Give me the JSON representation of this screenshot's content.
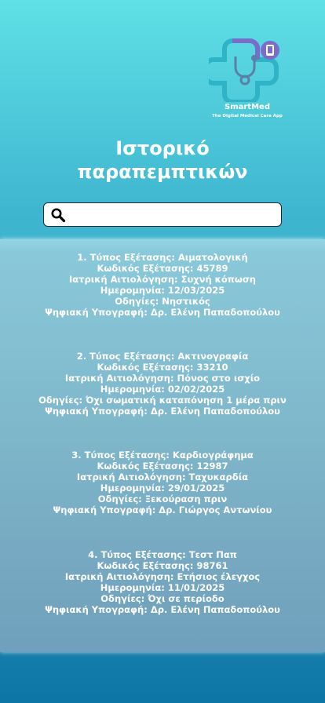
{
  "app": {
    "name": "SmartMed",
    "tagline": "The Digital Medical Care App"
  },
  "page": {
    "title_line1": "Ιστορικό",
    "title_line2": "παραπεμπτικών"
  },
  "search": {
    "value": "",
    "placeholder": ""
  },
  "referrals": [
    {
      "type": "1. Τύπος Εξέτασης: Αιματολογική",
      "code": "Κωδικός Εξέτασης: 45789",
      "reason": "Ιατρική Αιτιολόγηση: Συχνή κόπωση",
      "date": "Ημερομηνία: 12/03/2025",
      "instructions": "Οδηγίες: Νηστικός",
      "signature": "Ψηφιακή Υπογραφή: Δρ. Ελένη Παπαδοπούλου"
    },
    {
      "type": "2. Τύπος Εξέτασης: Ακτινογραφία",
      "code": "Κωδικός Εξέτασης: 33210",
      "reason": "Ιατρική Αιτιολόγηση: Πόνος στο ισχίο",
      "date": "Ημερομηνία: 02/02/2025",
      "instructions": "Οδηγίες: Όχι σωματική καταπόνηση 1 μέρα πριν",
      "signature": "Ψηφιακή Υπογραφή: Δρ. Ελένη Παπαδοπούλου"
    },
    {
      "type": "3. Τύπος Εξέτασης: Καρδιογράφημα",
      "code": "Κωδικός Εξέτασης: 12987",
      "reason": "Ιατρική Αιτιολόγηση: Ταχυκαρδία",
      "date": "Ημερομηνία: 29/01/2025",
      "instructions": "Οδηγίες: Ξεκούραση πριν",
      "signature": "Ψηφιακή Υπογραφή: Δρ. Γιώργος Αντωνίου"
    },
    {
      "type": "4. Τύπος Εξέτασης: Τεστ Παπ",
      "code": "Κωδικός Εξέτασης: 98761",
      "reason": "Ιατρική Αιτιολόγηση: Ετήσιος έλεγχος",
      "date": "Ημερομηνία: 11/01/2025",
      "instructions": "Οδηγίες: Όχι σε περίοδο",
      "signature": "Ψηφιακή Υπογραφή: Δρ. Ελένη Παπαδοπούλου"
    }
  ],
  "colors": {
    "background_top": "#5fe0e6",
    "background_bottom": "#0e76a6",
    "logo_primary": "#2fb3c6",
    "logo_accent": "#7a6cc9",
    "text": "#ffffff"
  },
  "icons": {
    "logo": "medical-cross-stethoscope-logo",
    "search": "magnifier-icon"
  }
}
